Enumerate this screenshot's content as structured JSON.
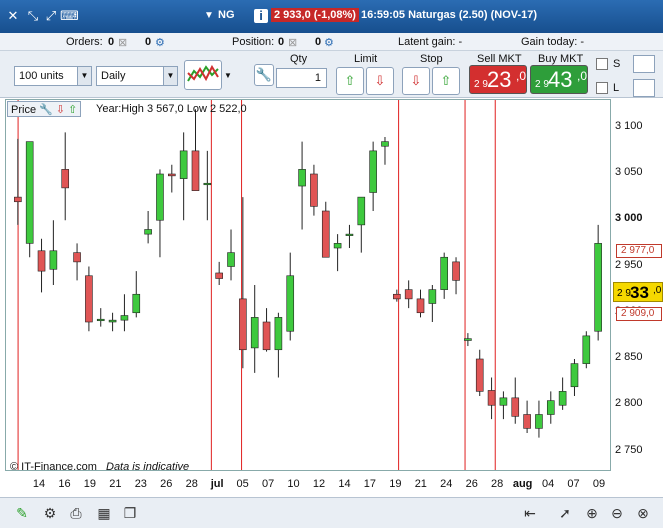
{
  "titlebar": {
    "instrument": "NG",
    "price_change": "2 933,0 (-1,08%)",
    "time_desc": "16:59:05 Naturgas (2.50) (NOV-17)"
  },
  "infobar": {
    "orders": "Orders:",
    "orders_val": "0",
    "orders_val2": "0",
    "position": "Position:",
    "position_val": "0",
    "position_val2": "0",
    "latent_gain": "Latent gain:  -",
    "gain_today": "Gain today:  -"
  },
  "toolbar": {
    "units": "100 units",
    "period": "Daily",
    "qty_label": "Qty",
    "qty_value": "1",
    "limit_label": "Limit",
    "stop_label": "Stop",
    "sell_label": "Sell MKT",
    "sell_small": "2 9",
    "sell_big": "23",
    "sell_sup": ",0",
    "buy_label": "Buy MKT",
    "buy_small": "2 9",
    "buy_big": "43",
    "buy_sup": ",0",
    "s_label": "S",
    "l_label": "L"
  },
  "chart": {
    "price_label": "Price",
    "year_info": "Year:High 3 567,0 Low 2 522,0",
    "copyright": "© IT-Finance.com",
    "indicative": "Data is indicative",
    "current_tag_small": "2 9",
    "current_tag_big": "33",
    "current_tag_sup": ",0",
    "tag_upper": "2 977,0",
    "tag_lower": "2 909,0",
    "colors": {
      "up": "#3ec93e",
      "down": "#e05555",
      "band": "#8f90d8",
      "line": "#e02020"
    }
  },
  "chart_data": {
    "type": "candlestick",
    "ylim": [
      2730,
      3130
    ],
    "yticks": [
      "3 100",
      "3 050",
      "3 000",
      "2 950",
      "2 900",
      "2 850",
      "2 800",
      "2 750"
    ],
    "xticks": [
      "14",
      "16",
      "19",
      "21",
      "23",
      "26",
      "28",
      "jul",
      "05",
      "07",
      "10",
      "12",
      "14",
      "17",
      "19",
      "21",
      "24",
      "26",
      "28",
      "aug",
      "04",
      "07",
      "09"
    ],
    "candles": [
      {
        "o": 3025,
        "h": 3088,
        "l": 2995,
        "c": 3020
      },
      {
        "o": 2975,
        "h": 3070,
        "l": 2960,
        "c": 3085
      },
      {
        "o": 2967,
        "h": 2980,
        "l": 2922,
        "c": 2945
      },
      {
        "o": 2947,
        "h": 3000,
        "l": 2930,
        "c": 2967
      },
      {
        "o": 3055,
        "h": 3095,
        "l": 3000,
        "c": 3035
      },
      {
        "o": 2965,
        "h": 2975,
        "l": 2935,
        "c": 2955
      },
      {
        "o": 2940,
        "h": 2950,
        "l": 2880,
        "c": 2890
      },
      {
        "o": 2893,
        "h": 2905,
        "l": 2885,
        "c": 2893
      },
      {
        "o": 2890,
        "h": 2900,
        "l": 2880,
        "c": 2892
      },
      {
        "o": 2892,
        "h": 2920,
        "l": 2880,
        "c": 2897
      },
      {
        "o": 2900,
        "h": 2945,
        "l": 2895,
        "c": 2920
      },
      {
        "o": 2985,
        "h": 3010,
        "l": 2975,
        "c": 2990
      },
      {
        "o": 3000,
        "h": 3055,
        "l": 2960,
        "c": 3050
      },
      {
        "o": 3050,
        "h": 3060,
        "l": 3030,
        "c": 3048
      },
      {
        "o": 3045,
        "h": 3095,
        "l": 3000,
        "c": 3075
      },
      {
        "o": 3075,
        "h": 3120,
        "l": 3035,
        "c": 3032
      },
      {
        "o": 3040,
        "h": 3075,
        "l": 3000,
        "c": 3040
      },
      {
        "o": 2943,
        "h": 2955,
        "l": 2930,
        "c": 2937
      },
      {
        "o": 2950,
        "h": 2990,
        "l": 2935,
        "c": 2965
      },
      {
        "o": 2915,
        "h": 3025,
        "l": 2840,
        "c": 2860
      },
      {
        "o": 2862,
        "h": 2930,
        "l": 2835,
        "c": 2895
      },
      {
        "o": 2890,
        "h": 2905,
        "l": 2858,
        "c": 2860
      },
      {
        "o": 2860,
        "h": 2900,
        "l": 2830,
        "c": 2895
      },
      {
        "o": 2880,
        "h": 2965,
        "l": 2870,
        "c": 2940
      },
      {
        "o": 3037,
        "h": 3085,
        "l": 2990,
        "c": 3055
      },
      {
        "o": 3050,
        "h": 3060,
        "l": 3005,
        "c": 3015
      },
      {
        "o": 3010,
        "h": 3020,
        "l": 2960,
        "c": 2960
      },
      {
        "o": 2970,
        "h": 2985,
        "l": 2945,
        "c": 2975
      },
      {
        "o": 2985,
        "h": 2995,
        "l": 2970,
        "c": 2985
      },
      {
        "o": 2995,
        "h": 3025,
        "l": 2965,
        "c": 3025
      },
      {
        "o": 3030,
        "h": 3085,
        "l": 3010,
        "c": 3075
      },
      {
        "o": 3080,
        "h": 3090,
        "l": 3060,
        "c": 3085
      },
      {
        "o": 2920,
        "h": 2925,
        "l": 2912,
        "c": 2915
      },
      {
        "o": 2925,
        "h": 2935,
        "l": 2905,
        "c": 2915
      },
      {
        "o": 2915,
        "h": 2925,
        "l": 2895,
        "c": 2900
      },
      {
        "o": 2910,
        "h": 2930,
        "l": 2890,
        "c": 2925
      },
      {
        "o": 2925,
        "h": 2965,
        "l": 2915,
        "c": 2960
      },
      {
        "o": 2955,
        "h": 2960,
        "l": 2920,
        "c": 2935
      },
      {
        "o": 2870,
        "h": 2878,
        "l": 2864,
        "c": 2872
      },
      {
        "o": 2850,
        "h": 2860,
        "l": 2810,
        "c": 2815
      },
      {
        "o": 2816,
        "h": 2830,
        "l": 2785,
        "c": 2800
      },
      {
        "o": 2800,
        "h": 2815,
        "l": 2785,
        "c": 2808
      },
      {
        "o": 2808,
        "h": 2830,
        "l": 2780,
        "c": 2788
      },
      {
        "o": 2790,
        "h": 2805,
        "l": 2770,
        "c": 2775
      },
      {
        "o": 2775,
        "h": 2805,
        "l": 2765,
        "c": 2790
      },
      {
        "o": 2790,
        "h": 2815,
        "l": 2780,
        "c": 2805
      },
      {
        "o": 2800,
        "h": 2830,
        "l": 2795,
        "c": 2815
      },
      {
        "o": 2820,
        "h": 2850,
        "l": 2810,
        "c": 2845
      },
      {
        "o": 2845,
        "h": 2880,
        "l": 2840,
        "c": 2875
      },
      {
        "o": 2880,
        "h": 2995,
        "l": 2870,
        "c": 2975
      }
    ]
  }
}
